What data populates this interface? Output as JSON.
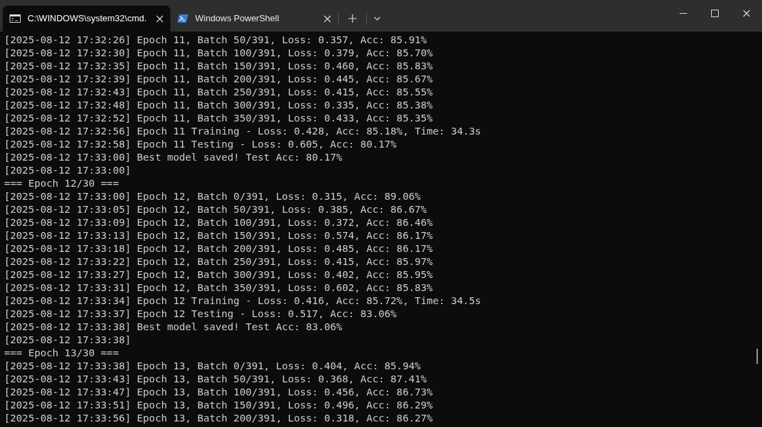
{
  "tabs": [
    {
      "title": "C:\\WINDOWS\\system32\\cmd.",
      "kind": "cmd",
      "selected": true
    },
    {
      "title": "Windows PowerShell",
      "kind": "powershell",
      "selected": false
    }
  ],
  "terminal": {
    "lines": [
      "[2025-08-12 17:32:26] Epoch 11, Batch 50/391, Loss: 0.357, Acc: 85.91%",
      "[2025-08-12 17:32:30] Epoch 11, Batch 100/391, Loss: 0.379, Acc: 85.70%",
      "[2025-08-12 17:32:35] Epoch 11, Batch 150/391, Loss: 0.460, Acc: 85.83%",
      "[2025-08-12 17:32:39] Epoch 11, Batch 200/391, Loss: 0.445, Acc: 85.67%",
      "[2025-08-12 17:32:43] Epoch 11, Batch 250/391, Loss: 0.415, Acc: 85.55%",
      "[2025-08-12 17:32:48] Epoch 11, Batch 300/391, Loss: 0.335, Acc: 85.38%",
      "[2025-08-12 17:32:52] Epoch 11, Batch 350/391, Loss: 0.433, Acc: 85.35%",
      "[2025-08-12 17:32:56] Epoch 11 Training - Loss: 0.428, Acc: 85.18%, Time: 34.3s",
      "[2025-08-12 17:32:58] Epoch 11 Testing - Loss: 0.605, Acc: 80.17%",
      "[2025-08-12 17:33:00] Best model saved! Test Acc: 80.17%",
      "[2025-08-12 17:33:00]",
      "=== Epoch 12/30 ===",
      "[2025-08-12 17:33:00] Epoch 12, Batch 0/391, Loss: 0.315, Acc: 89.06%",
      "[2025-08-12 17:33:05] Epoch 12, Batch 50/391, Loss: 0.385, Acc: 86.67%",
      "[2025-08-12 17:33:09] Epoch 12, Batch 100/391, Loss: 0.372, Acc: 86.46%",
      "[2025-08-12 17:33:13] Epoch 12, Batch 150/391, Loss: 0.574, Acc: 86.17%",
      "[2025-08-12 17:33:18] Epoch 12, Batch 200/391, Loss: 0.485, Acc: 86.17%",
      "[2025-08-12 17:33:22] Epoch 12, Batch 250/391, Loss: 0.415, Acc: 85.97%",
      "[2025-08-12 17:33:27] Epoch 12, Batch 300/391, Loss: 0.402, Acc: 85.95%",
      "[2025-08-12 17:33:31] Epoch 12, Batch 350/391, Loss: 0.602, Acc: 85.83%",
      "[2025-08-12 17:33:34] Epoch 12 Training - Loss: 0.416, Acc: 85.72%, Time: 34.5s",
      "[2025-08-12 17:33:37] Epoch 12 Testing - Loss: 0.517, Acc: 83.06%",
      "[2025-08-12 17:33:38] Best model saved! Test Acc: 83.06%",
      "[2025-08-12 17:33:38]",
      "=== Epoch 13/30 ===",
      "[2025-08-12 17:33:38] Epoch 13, Batch 0/391, Loss: 0.404, Acc: 85.94%",
      "[2025-08-12 17:33:43] Epoch 13, Batch 50/391, Loss: 0.368, Acc: 87.41%",
      "[2025-08-12 17:33:47] Epoch 13, Batch 100/391, Loss: 0.456, Acc: 86.73%",
      "[2025-08-12 17:33:51] Epoch 13, Batch 150/391, Loss: 0.496, Acc: 86.29%",
      "[2025-08-12 17:33:56] Epoch 13, Batch 200/391, Loss: 0.318, Acc: 86.27%"
    ]
  }
}
